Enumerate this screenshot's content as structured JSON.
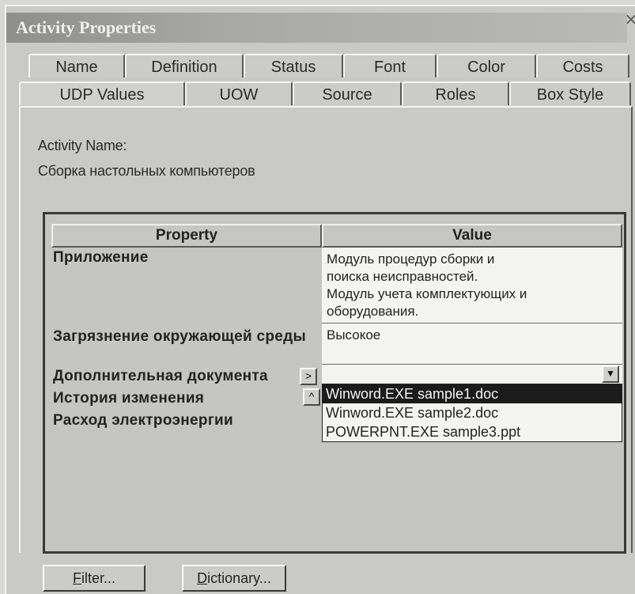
{
  "window": {
    "title": "Activity Properties",
    "close_glyph": "×"
  },
  "tabs": {
    "row1": [
      "Name",
      "Definition",
      "Status",
      "Font",
      "Color",
      "Costs"
    ],
    "row2": [
      "UDP Values",
      "UOW",
      "Source",
      "Roles",
      "Box Style"
    ],
    "active": "UDP Values"
  },
  "activity": {
    "name_label": "Activity Name:",
    "name_value": "Сборка настольных компьютеров"
  },
  "grid": {
    "headers": {
      "property": "Property",
      "value": "Value"
    },
    "rows": [
      {
        "property": "Приложение",
        "value": [
          "Модуль процедур сборки  и",
          "поиска неисправностей.",
          "Модуль учета комплектующих и",
          "оборудования."
        ]
      },
      {
        "property": "Загрязнение окружающей среды",
        "value": "Высокое"
      },
      {
        "property": "Дополнительная документа",
        "button": ">"
      },
      {
        "property": "История изменения",
        "button": "^"
      },
      {
        "property": "Расход электроэнергии"
      }
    ],
    "dropdown": {
      "arrow_glyph": "▼",
      "options": [
        "Winword.EXE sample1.doc",
        "Winword.EXE sample2.doc",
        "POWERPNT.EXE sample3.ppt"
      ],
      "selected": "Winword.EXE sample1.doc"
    }
  },
  "buttons": {
    "filter": {
      "accel": "F",
      "rest": "ilter..."
    },
    "dictionary": {
      "accel": "D",
      "rest": "ictionary..."
    }
  }
}
